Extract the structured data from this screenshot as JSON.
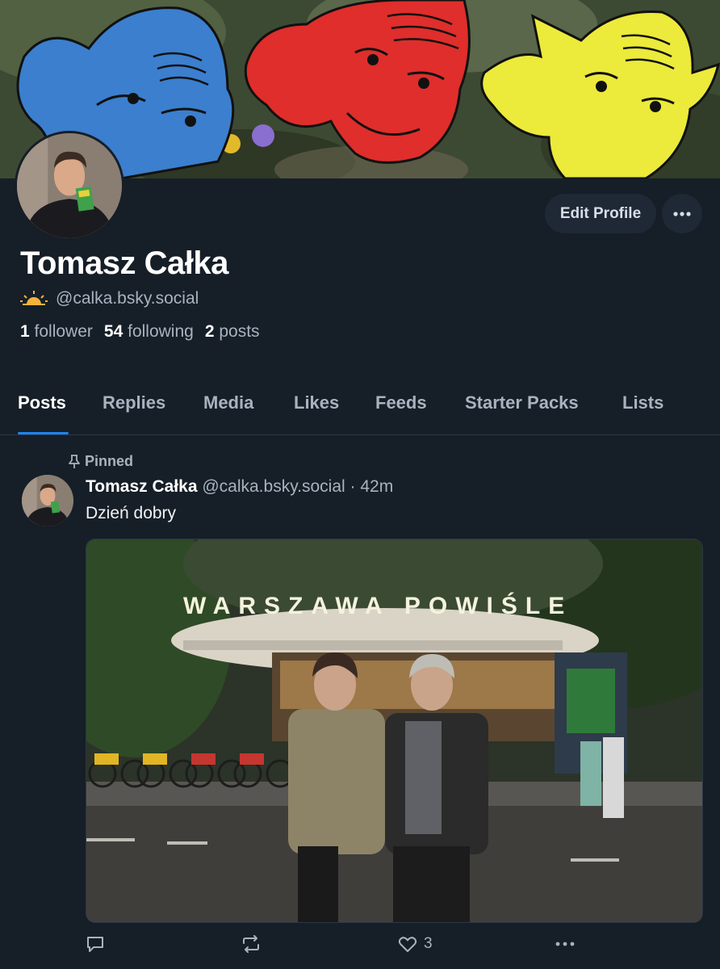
{
  "profile": {
    "display_name": "Tomasz Całka",
    "handle": "@calka.bsky.social",
    "followers_count": "1",
    "followers_label": "follower",
    "following_count": "54",
    "following_label": "following",
    "posts_count": "2",
    "posts_label": "posts",
    "handle_icon": "sun-icon",
    "banner": "banner-image",
    "avatar": "avatar-image"
  },
  "actions": {
    "edit_profile": "Edit Profile",
    "more_icon": "ellipsis-icon"
  },
  "tabs": [
    {
      "label": "Posts",
      "active": true
    },
    {
      "label": "Replies"
    },
    {
      "label": "Media"
    },
    {
      "label": "Likes"
    },
    {
      "label": "Feeds"
    },
    {
      "label": "Starter Packs"
    },
    {
      "label": "Lists"
    }
  ],
  "post": {
    "pinned_label": "Pinned",
    "author": "Tomasz Całka",
    "handle": "@calka.bsky.social",
    "time": "42m",
    "text": "Dzień dobry",
    "image_sign_text": "WARSZAWA POWIŚLE",
    "reply_count": "",
    "repost_count": "",
    "like_count": "3"
  },
  "colors": {
    "background": "#161e27",
    "accent": "#1f83f0",
    "muted_text": "#a8b3bf",
    "button_bg": "#1e2935"
  }
}
